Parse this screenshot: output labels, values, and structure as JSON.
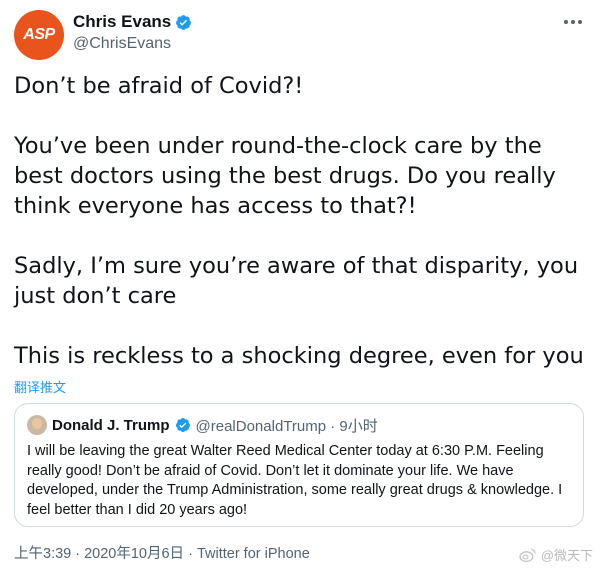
{
  "author": {
    "avatar_text": "ASP",
    "display_name": "Chris Evans",
    "handle": "@ChrisEvans",
    "verified_icon": "verified-badge-icon"
  },
  "tweet": {
    "paragraphs": [
      "Don’t be afraid of Covid?!",
      "You’ve been under round-the-clock care by the best doctors using the best drugs. Do you really think everyone has access to that?!",
      "Sadly, I’m sure you’re aware of that disparity, you just don’t care",
      "This is reckless to a shocking degree, even for you"
    ],
    "translate_label": "翻译推文"
  },
  "quoted_tweet": {
    "display_name": "Donald J. Trump",
    "handle_time": "@realDonaldTrump · 9小时",
    "text": "I will be leaving the great Walter Reed Medical Center today at 6:30 P.M. Feeling really good! Don’t be afraid of Covid. Don’t let it dominate your life. We have developed, under the Trump Administration, some really great drugs & knowledge. I feel better than I did 20 years ago!"
  },
  "meta": {
    "timestamp_source": "上午3:39 · 2020年10月6日 · Twitter for iPhone"
  },
  "watermark": {
    "text": "@微天下"
  },
  "colors": {
    "accent": "#1d9bf0",
    "avatar": "#e8541c",
    "muted": "#536471"
  }
}
